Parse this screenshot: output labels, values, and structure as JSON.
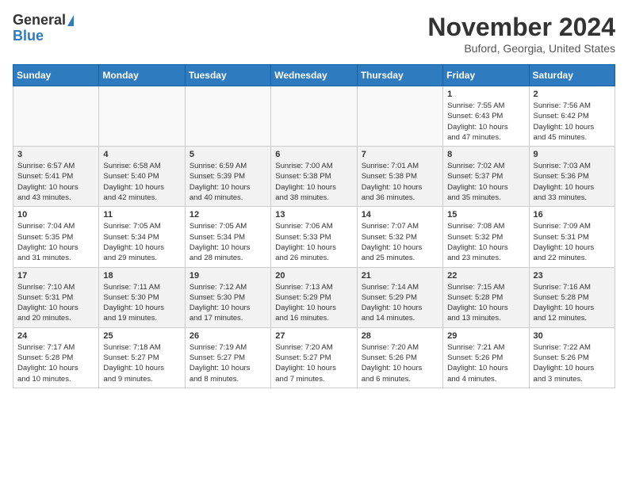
{
  "header": {
    "logo_general": "General",
    "logo_blue": "Blue",
    "title": "November 2024",
    "location": "Buford, Georgia, United States"
  },
  "weekdays": [
    "Sunday",
    "Monday",
    "Tuesday",
    "Wednesday",
    "Thursday",
    "Friday",
    "Saturday"
  ],
  "weeks": [
    [
      {
        "day": "",
        "info": ""
      },
      {
        "day": "",
        "info": ""
      },
      {
        "day": "",
        "info": ""
      },
      {
        "day": "",
        "info": ""
      },
      {
        "day": "",
        "info": ""
      },
      {
        "day": "1",
        "info": "Sunrise: 7:55 AM\nSunset: 6:43 PM\nDaylight: 10 hours\nand 47 minutes."
      },
      {
        "day": "2",
        "info": "Sunrise: 7:56 AM\nSunset: 6:42 PM\nDaylight: 10 hours\nand 45 minutes."
      }
    ],
    [
      {
        "day": "3",
        "info": "Sunrise: 6:57 AM\nSunset: 5:41 PM\nDaylight: 10 hours\nand 43 minutes."
      },
      {
        "day": "4",
        "info": "Sunrise: 6:58 AM\nSunset: 5:40 PM\nDaylight: 10 hours\nand 42 minutes."
      },
      {
        "day": "5",
        "info": "Sunrise: 6:59 AM\nSunset: 5:39 PM\nDaylight: 10 hours\nand 40 minutes."
      },
      {
        "day": "6",
        "info": "Sunrise: 7:00 AM\nSunset: 5:38 PM\nDaylight: 10 hours\nand 38 minutes."
      },
      {
        "day": "7",
        "info": "Sunrise: 7:01 AM\nSunset: 5:38 PM\nDaylight: 10 hours\nand 36 minutes."
      },
      {
        "day": "8",
        "info": "Sunrise: 7:02 AM\nSunset: 5:37 PM\nDaylight: 10 hours\nand 35 minutes."
      },
      {
        "day": "9",
        "info": "Sunrise: 7:03 AM\nSunset: 5:36 PM\nDaylight: 10 hours\nand 33 minutes."
      }
    ],
    [
      {
        "day": "10",
        "info": "Sunrise: 7:04 AM\nSunset: 5:35 PM\nDaylight: 10 hours\nand 31 minutes."
      },
      {
        "day": "11",
        "info": "Sunrise: 7:05 AM\nSunset: 5:34 PM\nDaylight: 10 hours\nand 29 minutes."
      },
      {
        "day": "12",
        "info": "Sunrise: 7:05 AM\nSunset: 5:34 PM\nDaylight: 10 hours\nand 28 minutes."
      },
      {
        "day": "13",
        "info": "Sunrise: 7:06 AM\nSunset: 5:33 PM\nDaylight: 10 hours\nand 26 minutes."
      },
      {
        "day": "14",
        "info": "Sunrise: 7:07 AM\nSunset: 5:32 PM\nDaylight: 10 hours\nand 25 minutes."
      },
      {
        "day": "15",
        "info": "Sunrise: 7:08 AM\nSunset: 5:32 PM\nDaylight: 10 hours\nand 23 minutes."
      },
      {
        "day": "16",
        "info": "Sunrise: 7:09 AM\nSunset: 5:31 PM\nDaylight: 10 hours\nand 22 minutes."
      }
    ],
    [
      {
        "day": "17",
        "info": "Sunrise: 7:10 AM\nSunset: 5:31 PM\nDaylight: 10 hours\nand 20 minutes."
      },
      {
        "day": "18",
        "info": "Sunrise: 7:11 AM\nSunset: 5:30 PM\nDaylight: 10 hours\nand 19 minutes."
      },
      {
        "day": "19",
        "info": "Sunrise: 7:12 AM\nSunset: 5:30 PM\nDaylight: 10 hours\nand 17 minutes."
      },
      {
        "day": "20",
        "info": "Sunrise: 7:13 AM\nSunset: 5:29 PM\nDaylight: 10 hours\nand 16 minutes."
      },
      {
        "day": "21",
        "info": "Sunrise: 7:14 AM\nSunset: 5:29 PM\nDaylight: 10 hours\nand 14 minutes."
      },
      {
        "day": "22",
        "info": "Sunrise: 7:15 AM\nSunset: 5:28 PM\nDaylight: 10 hours\nand 13 minutes."
      },
      {
        "day": "23",
        "info": "Sunrise: 7:16 AM\nSunset: 5:28 PM\nDaylight: 10 hours\nand 12 minutes."
      }
    ],
    [
      {
        "day": "24",
        "info": "Sunrise: 7:17 AM\nSunset: 5:28 PM\nDaylight: 10 hours\nand 10 minutes."
      },
      {
        "day": "25",
        "info": "Sunrise: 7:18 AM\nSunset: 5:27 PM\nDaylight: 10 hours\nand 9 minutes."
      },
      {
        "day": "26",
        "info": "Sunrise: 7:19 AM\nSunset: 5:27 PM\nDaylight: 10 hours\nand 8 minutes."
      },
      {
        "day": "27",
        "info": "Sunrise: 7:20 AM\nSunset: 5:27 PM\nDaylight: 10 hours\nand 7 minutes."
      },
      {
        "day": "28",
        "info": "Sunrise: 7:20 AM\nSunset: 5:26 PM\nDaylight: 10 hours\nand 6 minutes."
      },
      {
        "day": "29",
        "info": "Sunrise: 7:21 AM\nSunset: 5:26 PM\nDaylight: 10 hours\nand 4 minutes."
      },
      {
        "day": "30",
        "info": "Sunrise: 7:22 AM\nSunset: 5:26 PM\nDaylight: 10 hours\nand 3 minutes."
      }
    ]
  ]
}
